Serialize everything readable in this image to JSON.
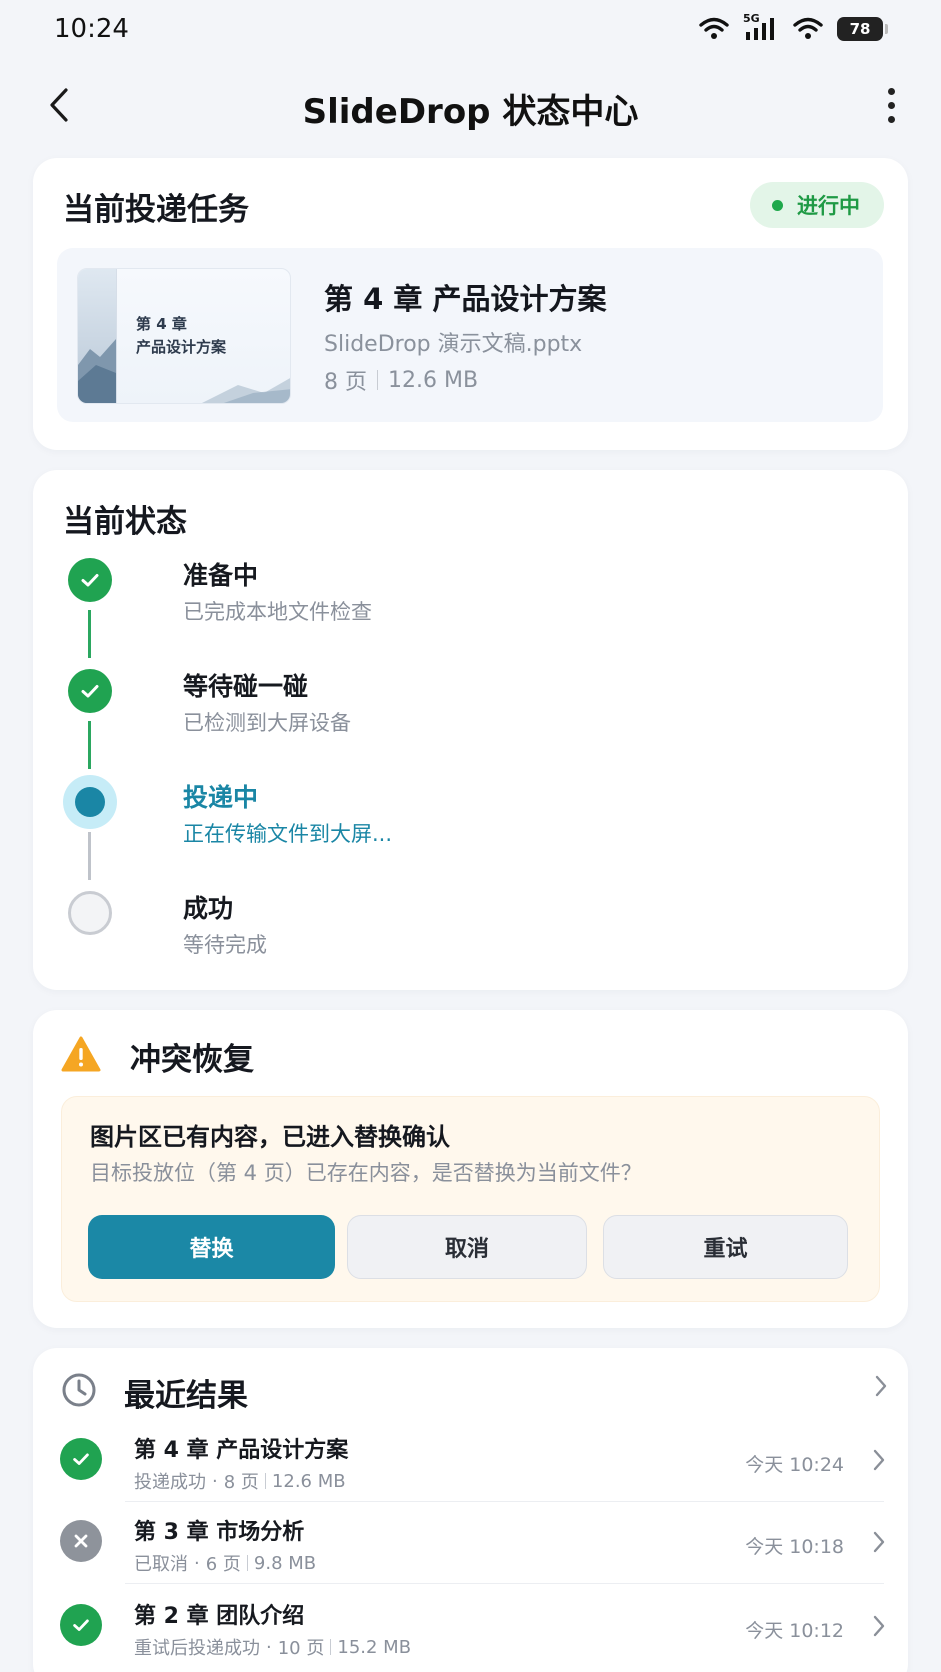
{
  "status_bar": {
    "time": "10:24",
    "network": "5G",
    "battery": "78"
  },
  "app_bar": {
    "title": "SlideDrop 状态中心"
  },
  "task": {
    "heading": "当前投递任务",
    "badge": "进行中",
    "thumb_line1": "第 4 章",
    "thumb_line2": "产品设计方案",
    "title": "第 4 章 产品设计方案",
    "file_name": "SlideDrop 演示文稿.pptx",
    "pages": "8 页",
    "size": "12.6 MB"
  },
  "status": {
    "heading": "当前状态",
    "steps": [
      {
        "label": "准备中",
        "desc": "已完成本地文件检查",
        "state": "done"
      },
      {
        "label": "等待碰一碰",
        "desc": "已检测到大屏设备",
        "state": "done"
      },
      {
        "label": "投递中",
        "desc": "正在传输文件到大屏...",
        "state": "active"
      },
      {
        "label": "成功",
        "desc": "等待完成",
        "state": "pending"
      }
    ]
  },
  "conflict": {
    "heading": "冲突恢复",
    "title": "图片区已有内容，已进入替换确认",
    "desc": "目标投放位（第 4 页）已存在内容，是否替换为当前文件？",
    "replace_label": "替换",
    "cancel_label": "取消",
    "retry_label": "重试"
  },
  "recent": {
    "heading": "最近结果",
    "items": [
      {
        "title": "第 4 章 产品设计方案",
        "status": "投递成功",
        "pages": "8 页",
        "size": "12.6 MB",
        "time": "今天 10:24",
        "icon": "check-icon"
      },
      {
        "title": "第 3 章 市场分析",
        "status": "已取消",
        "pages": "6 页",
        "size": "9.8 MB",
        "time": "今天 10:18",
        "icon": "close-icon"
      },
      {
        "title": "第 2 章 团队介绍",
        "status": "重试后投递成功",
        "pages": "10 页",
        "size": "15.2 MB",
        "time": "今天 10:12",
        "icon": "check-icon"
      }
    ]
  },
  "colors": {
    "accent": "#1b88a6",
    "success": "#20a351",
    "warning": "#f5a623",
    "badge_text": "#1f9a45"
  }
}
